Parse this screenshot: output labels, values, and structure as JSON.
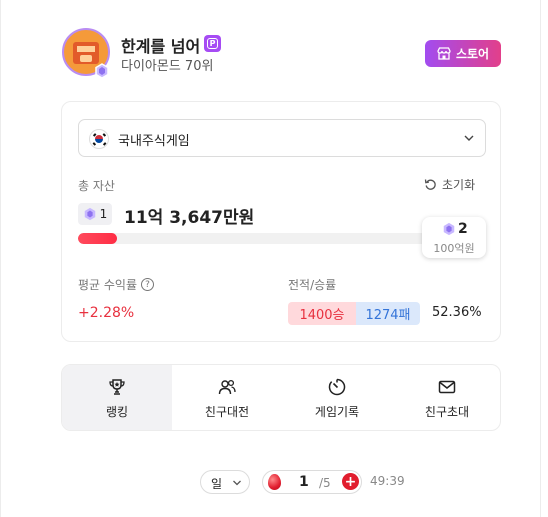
{
  "profile": {
    "nickname": "한계를 넘어",
    "premium_badge": "P",
    "tier_rank": "다이아몬드 70위",
    "store_label": "스토어"
  },
  "card": {
    "game_selected": "국내주식게임",
    "total_assets_label": "총 자산",
    "reset_label": "초기화",
    "current_rank": "1",
    "asset_value": "11억 3,647만원",
    "progress_fraction": 0.11,
    "next_rank": "2",
    "next_threshold": "100억원",
    "avg_yield_label": "평균 수익률",
    "avg_yield_value": "+2.28%",
    "record_label": "전적/승률",
    "wins": "1400승",
    "losses": "1274패",
    "win_rate": "52.36%"
  },
  "nav": [
    {
      "label": "랭킹",
      "icon": "trophy-icon",
      "active": true
    },
    {
      "label": "친구대전",
      "icon": "friends-icon",
      "active": false
    },
    {
      "label": "게임기록",
      "icon": "timer-icon",
      "active": false
    },
    {
      "label": "친구초대",
      "icon": "mail-icon",
      "active": false
    }
  ],
  "bottom": {
    "period": "일",
    "count": "1",
    "count_max": "/5",
    "timer": "49:39"
  },
  "colors": {
    "accent_red": "#e8313f",
    "loss_blue": "#3474d8",
    "store_gradient_start": "#a24cf0",
    "store_gradient_end": "#e23f8a"
  }
}
